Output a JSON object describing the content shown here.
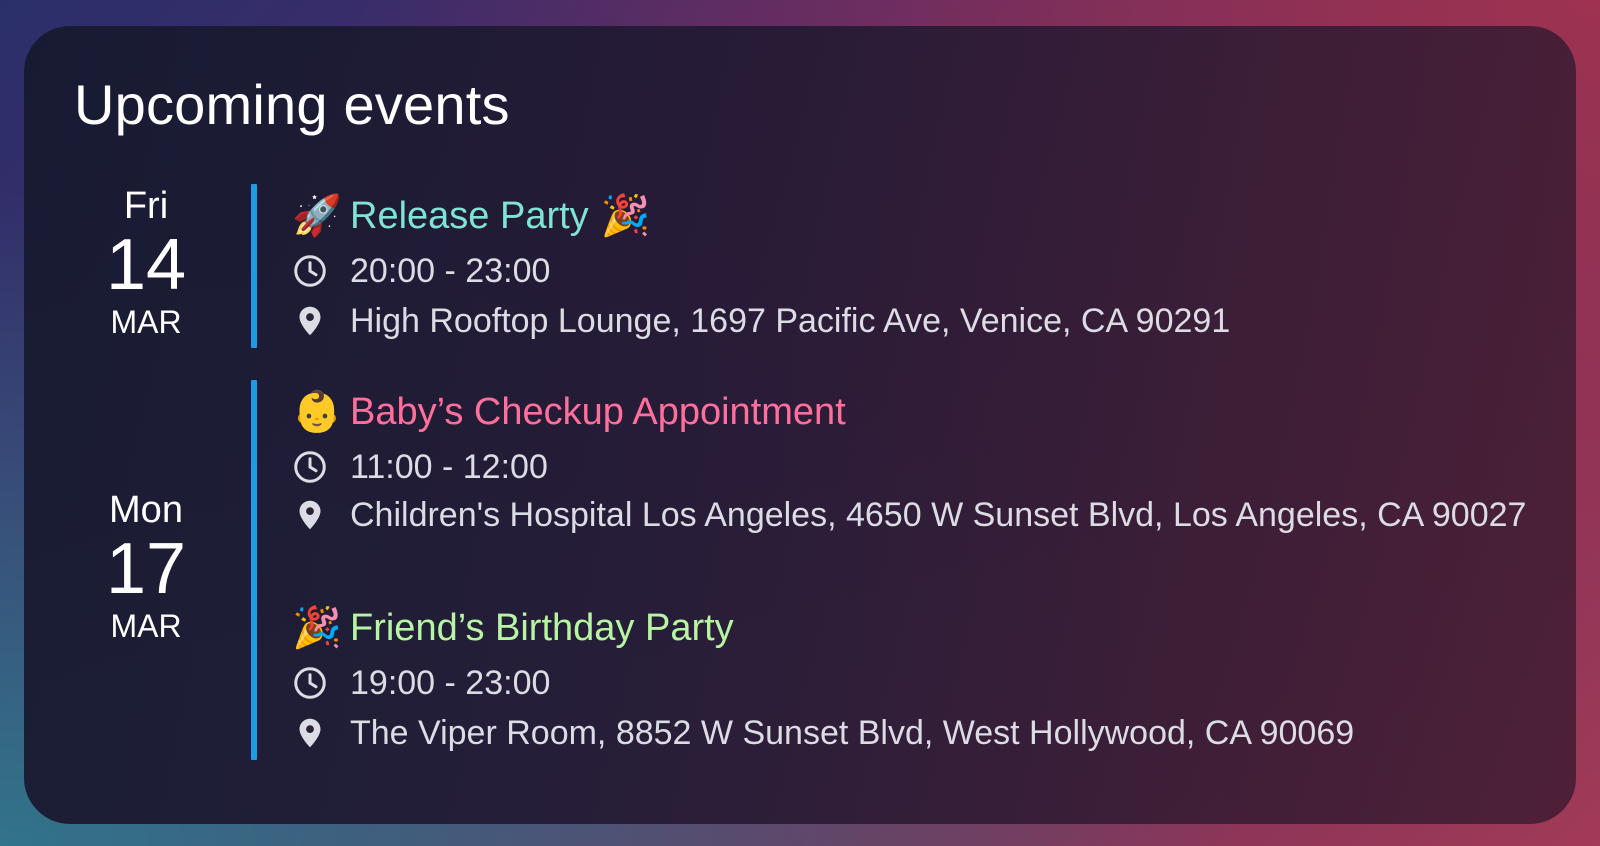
{
  "widget": {
    "title": "Upcoming events"
  },
  "days": [
    {
      "weekday": "Fri",
      "day": "14",
      "month": "MAR",
      "events": [
        {
          "emoji_before": "🚀",
          "title": "Release Party",
          "emoji_after": "🎉",
          "title_color": "#7fe3d6",
          "time": "20:00 - 23:00",
          "location": "High Rooftop Lounge, 1697 Pacific Ave, Venice, CA 90291",
          "time_icon": "clock-icon",
          "location_icon": "map-pin-icon"
        }
      ]
    },
    {
      "weekday": "Mon",
      "day": "17",
      "month": "MAR",
      "events": [
        {
          "emoji_before": "👶",
          "title": "Baby’s Checkup Appointment",
          "title_color": "#ff6f9c",
          "time": "11:00 - 12:00",
          "location": "Children's Hospital Los Angeles, 4650 W Sunset Blvd, Los Angeles, CA 90027",
          "time_icon": "clock-icon",
          "location_icon": "map-pin-icon"
        },
        {
          "emoji_before": "🎉",
          "title": "Friend’s Birthday Party",
          "title_color": "#b8f5a2",
          "time": "19:00 - 23:00",
          "location": "The Viper Room, 8852 W Sunset Blvd, West Hollywood, CA 90069",
          "time_icon": "clock-icon",
          "location_icon": "map-pin-icon"
        }
      ]
    }
  ],
  "colors": {
    "accent_bar": "#1e9be6",
    "detail_text": "#dcdce4"
  }
}
